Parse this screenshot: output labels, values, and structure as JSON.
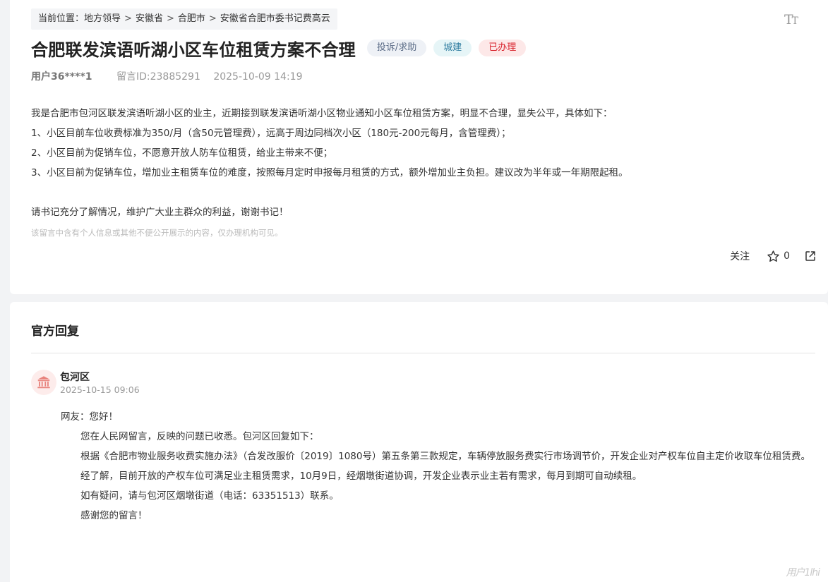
{
  "breadcrumb": {
    "prefix": "当前位置：",
    "items": [
      "地方领导",
      "安徽省",
      "合肥市",
      "安徽省合肥市委书记费高云"
    ],
    "sep": ">"
  },
  "font_toggle": {
    "big": "T",
    "small": "T"
  },
  "post": {
    "title": "合肥联发滨语听湖小区车位租赁方案不合理",
    "tags": [
      "投诉/求助",
      "城建",
      "已办理"
    ],
    "user": "用户36****1",
    "message_id": "留言ID:23885291",
    "datetime": "2025-10-09 14:19",
    "content": [
      "我是合肥市包河区联发滨语听湖小区的业主，近期接到联发滨语听湖小区物业通知小区车位租赁方案，明显不合理，显失公平，具体如下：",
      "1、小区目前车位收费标准为350/月（含50元管理费），远高于周边同档次小区（180元-200元每月，含管理费）；",
      "2、小区目前为促销车位，不愿意开放人防车位租赁，给业主带来不便；",
      "3、小区目前为促销车位，增加业主租赁车位的难度，按照每月定时申报每月租赁的方式，额外增加业主负担。建议改为半年或一年期限起租。",
      "请书记充分了解情况，维护广大业主群众的利益，谢谢书记！"
    ],
    "privacy_note": "该留言中含有个人信息或其他不便公开展示的内容，仅办理机构可见。"
  },
  "actions": {
    "follow": "关注",
    "star_count": "0"
  },
  "reply": {
    "section_title": "官方回复",
    "org": "包河区",
    "datetime": "2025-10-15 09:06",
    "greeting": "网友：您好！",
    "para1": "您在人民网留言，反映的问题已收悉。包河区回复如下：",
    "para2": "根据《合肥市物业服务收费实施办法》（合发改服价〔2019〕1080号）第五条第三款规定，车辆停放服务费实行市场调节价，开发企业对产权车位自主定价收取车位租赁费。",
    "para3": "经了解，目前开放的产权车位可满足业主租赁需求，10月9日，经烟墩街道协调，开发企业表示业主若有需求，每月到期可自动续租。",
    "para4": "如有疑问，请与包河区烟墩街道（电话：63351513）联系。",
    "para5": "感谢您的留言！"
  },
  "watermark": "用户1lhi"
}
